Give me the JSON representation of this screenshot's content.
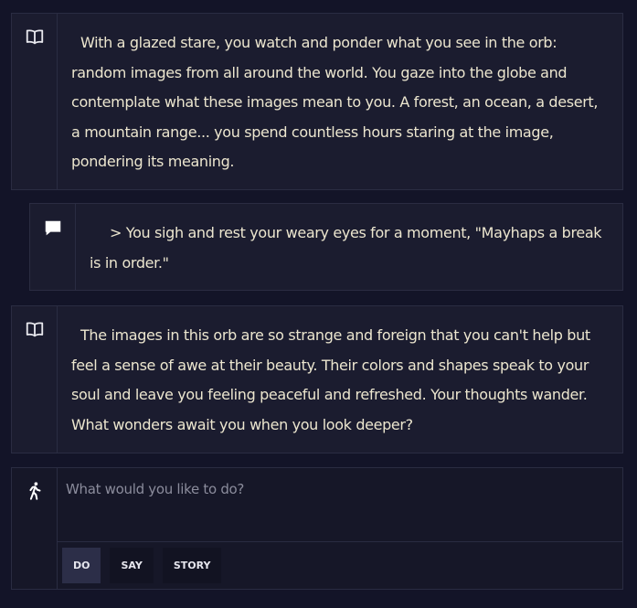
{
  "feed": [
    {
      "type": "story",
      "icon": "book-icon",
      "text": "With a glazed stare, you watch and ponder what you see in the orb: random images from all around the world. You gaze into the globe and contemplate what these images mean to you. A forest, an ocean, a desert, a mountain range... you spend countless hours staring at the image, pondering its meaning."
    },
    {
      "type": "action",
      "icon": "speech-bubble-icon",
      "text": "> You sigh and rest your weary eyes for a moment, \"Mayhaps a break is in order.\""
    },
    {
      "type": "story",
      "icon": "book-icon",
      "text": "The images in this orb are so strange and foreign that you can't help but feel a sense of awe at their beauty. Their colors and shapes speak to your soul and leave you feeling peaceful and refreshed. Your thoughts wander. What wonders await you when you look deeper?"
    }
  ],
  "input": {
    "icon": "walking-person-icon",
    "placeholder": "What would you like to do?",
    "value": ""
  },
  "modes": [
    {
      "label": "DO",
      "active": true
    },
    {
      "label": "SAY",
      "active": false
    },
    {
      "label": "STORY",
      "active": false
    }
  ],
  "colors": {
    "background": "#131428",
    "card": "#1b1c2f",
    "border": "#2a2c42",
    "text": "#ece6cf",
    "active_mode": "#2c2e48"
  }
}
